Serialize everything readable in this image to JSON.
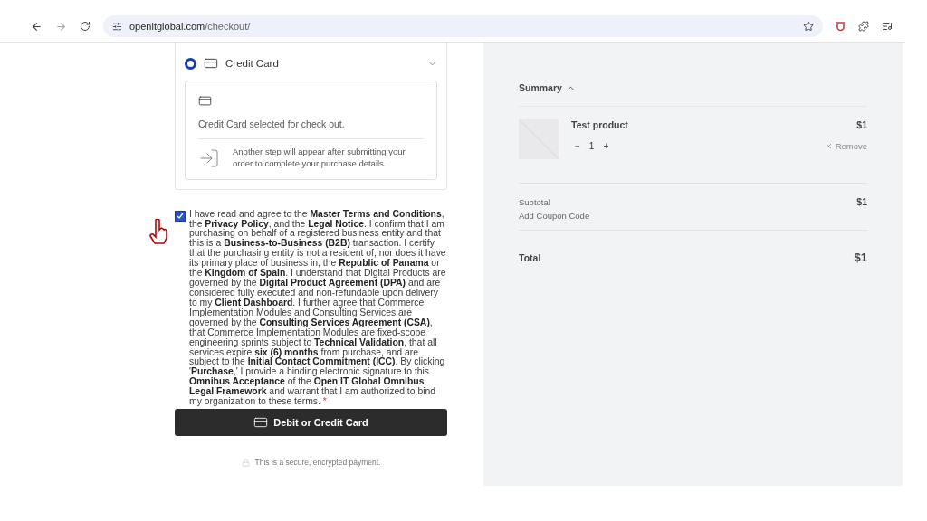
{
  "browser": {
    "url_host": "openitglobal.com",
    "url_path": "/checkout/"
  },
  "payment_method": {
    "label": "Credit Card",
    "selected": true,
    "expanded": true,
    "info": "Credit Card selected for check out.",
    "note": "Another step will appear after submitting your order to complete your purchase details."
  },
  "agreement": {
    "checked": true,
    "text": "I have read and agree to the **Master Terms and Conditions**, the **Privacy Policy**, and the **Legal Notice**. I confirm that I am purchasing on behalf of a registered business entity and that this is a **Business-to-Business (B2B)** transaction. I certify that the purchasing entity is not a resident of, nor does it have its primary place of business in, the **Republic of Panama** or the **Kingdom of Spain**. I understand that Digital Products are governed by the **Digital Product Agreement (DPA)**  and are considered fully executed and non-refundable upon delivery to my **Client Dashboard**. I further agree that Commerce Implementation Modules and Consulting Services are governed by the **Consulting Services Agreement (CSA)**, that Commerce Implementation Modules are fixed-scope engineering sprints subject to **Technical Validation**, that all services expire **six (6) months** from purchase, and are subject to the **Initial Contact Commitment (ICC)**. By clicking '**Purchase**,' I provide a binding electronic signature to this **Omnibus Acceptance** of the **Open IT Global Omnibus Legal Framework** and warrant that I am authorized to bind my organization to these terms.",
    "required_mark": "*"
  },
  "pay_button": "Debit or Credit Card",
  "secure_note": "This is a secure, encrypted payment.",
  "summary": {
    "title": "Summary",
    "expanded": true,
    "items": [
      {
        "name": "Test product",
        "price": "$1",
        "minus": "−",
        "quantity": "1",
        "plus": "+",
        "remove": "Remove"
      }
    ],
    "subtotal_label": "Subtotal",
    "subtotal": "$1",
    "coupon": "Add Coupon Code",
    "total_label": "Total",
    "total": "$1"
  }
}
